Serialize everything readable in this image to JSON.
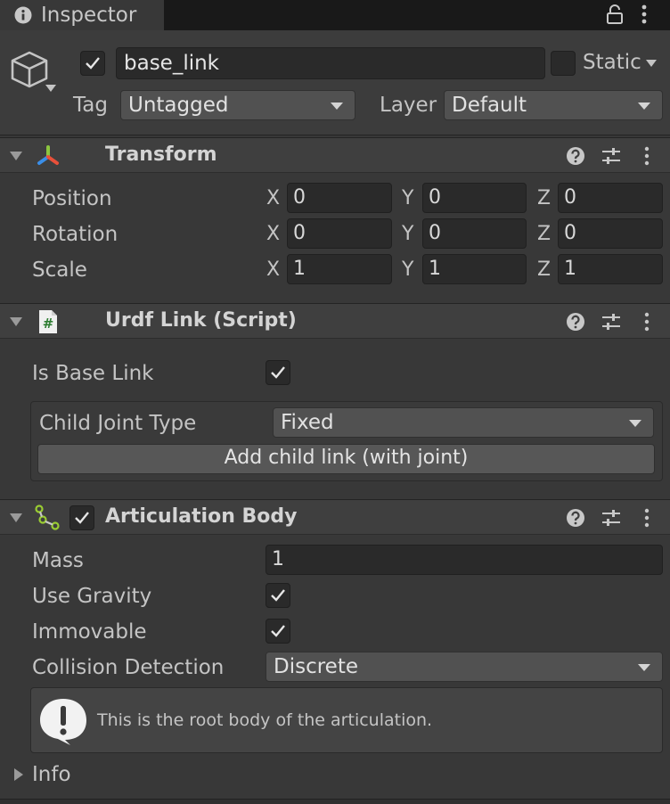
{
  "window": {
    "tab_title": "Inspector"
  },
  "header": {
    "object_active": true,
    "object_name": "base_link",
    "static_label": "Static",
    "tag_label": "Tag",
    "tag_value": "Untagged",
    "layer_label": "Layer",
    "layer_value": "Default"
  },
  "transform": {
    "title": "Transform",
    "rows": [
      {
        "label": "Position",
        "x": "0",
        "y": "0",
        "z": "0"
      },
      {
        "label": "Rotation",
        "x": "0",
        "y": "0",
        "z": "0"
      },
      {
        "label": "Scale",
        "x": "1",
        "y": "1",
        "z": "1"
      }
    ],
    "axes": [
      "X",
      "Y",
      "Z"
    ]
  },
  "urdf_link": {
    "title": "Urdf Link (Script)",
    "is_base_link_label": "Is Base Link",
    "is_base_link": true,
    "child_joint_type_label": "Child Joint Type",
    "child_joint_type_value": "Fixed",
    "add_child_button": "Add child link (with joint)"
  },
  "articulation_body": {
    "title": "Articulation Body",
    "enabled": true,
    "mass_label": "Mass",
    "mass_value": "1",
    "use_gravity_label": "Use Gravity",
    "use_gravity": true,
    "immovable_label": "Immovable",
    "immovable": true,
    "collision_detection_label": "Collision Detection",
    "collision_detection_value": "Discrete",
    "info_message": "This is the root body of the articulation.",
    "info_foldout_label": "Info"
  },
  "colors": {
    "background": "#383838",
    "field": "#2a2a2a",
    "dropdown": "#515151",
    "transform_axis_red": "#e8503a",
    "transform_axis_green": "#8cc63f",
    "transform_axis_blue": "#3a8ee8",
    "script_icon_green": "#2e7d32",
    "articulation_icon_green": "#9acd32"
  },
  "icons": {
    "tab": "info-icon",
    "lock": "lock-icon",
    "menu": "kebab-icon",
    "object": "cube-icon",
    "transform": "transform-gizmo-icon",
    "script": "csharp-script-icon",
    "articulation": "articulation-body-icon",
    "help": "help-icon",
    "presets": "presets-icon",
    "warning": "exclamation-bubble-icon"
  }
}
